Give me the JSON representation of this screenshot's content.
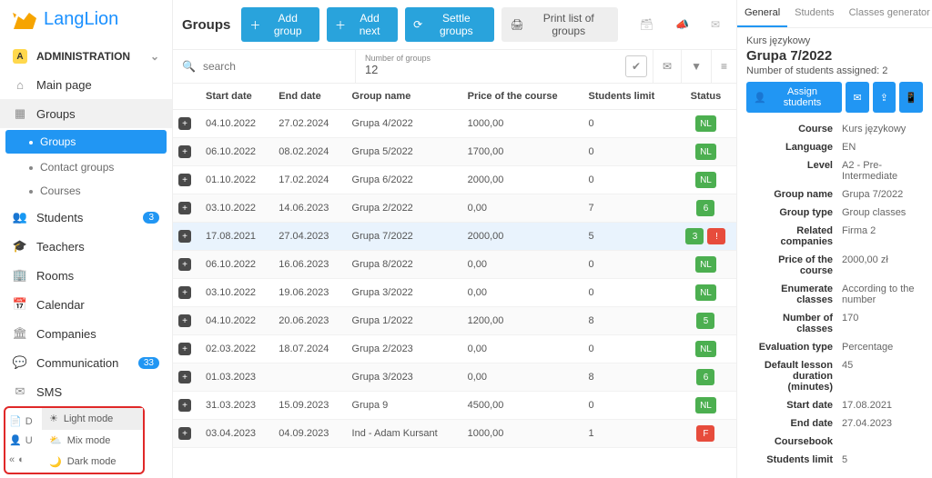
{
  "brand": "LangLion",
  "sidebar": {
    "adminBadge": "A",
    "adminLabel": "ADMINISTRATION",
    "items": [
      {
        "label": "Main page"
      },
      {
        "label": "Groups"
      },
      {
        "label": "Students",
        "badge": "3"
      },
      {
        "label": "Teachers"
      },
      {
        "label": "Rooms"
      },
      {
        "label": "Calendar"
      },
      {
        "label": "Companies"
      },
      {
        "label": "Communication",
        "badge": "33"
      },
      {
        "label": "SMS"
      },
      {
        "label": "D"
      },
      {
        "label": "U"
      }
    ],
    "subgroups": [
      {
        "label": "Groups",
        "active": true
      },
      {
        "label": "Contact groups"
      },
      {
        "label": "Courses"
      }
    ]
  },
  "modes": {
    "light": "Light mode",
    "mix": "Mix mode",
    "dark": "Dark mode"
  },
  "header": {
    "title": "Groups",
    "addGroup": "Add group",
    "addNext": "Add next",
    "settle": "Settle groups",
    "print": "Print list of groups"
  },
  "filter": {
    "search_ph": "search",
    "ngroups_label": "Number of groups",
    "ngroups_value": "12"
  },
  "columns": {
    "start": "Start date",
    "end": "End date",
    "group": "Group name",
    "price": "Price of the course",
    "limit": "Students limit",
    "status": "Status"
  },
  "rows": [
    {
      "start": "04.10.2022",
      "end": "27.02.2024",
      "group": "Grupa 4/2022",
      "price": "1000,00",
      "limit": "0",
      "status": [
        "NL"
      ]
    },
    {
      "start": "06.10.2022",
      "end": "08.02.2024",
      "group": "Grupa 5/2022",
      "price": "1700,00",
      "limit": "0",
      "status": [
        "NL"
      ]
    },
    {
      "start": "01.10.2022",
      "end": "17.02.2024",
      "group": "Grupa 6/2022",
      "price": "2000,00",
      "limit": "0",
      "status": [
        "NL"
      ]
    },
    {
      "start": "03.10.2022",
      "end": "14.06.2023",
      "group": "Grupa 2/2022",
      "price": "0,00",
      "limit": "7",
      "status": [
        "6"
      ]
    },
    {
      "start": "17.08.2021",
      "end": "27.04.2023",
      "group": "Grupa 7/2022",
      "price": "2000,00",
      "limit": "5",
      "status": [
        "3",
        "!"
      ],
      "selected": true
    },
    {
      "start": "06.10.2022",
      "end": "16.06.2023",
      "group": "Grupa 8/2022",
      "price": "0,00",
      "limit": "0",
      "status": [
        "NL"
      ]
    },
    {
      "start": "03.10.2022",
      "end": "19.06.2023",
      "group": "Grupa 3/2022",
      "price": "0,00",
      "limit": "0",
      "status": [
        "NL"
      ]
    },
    {
      "start": "04.10.2022",
      "end": "20.06.2023",
      "group": "Grupa 1/2022",
      "price": "1200,00",
      "limit": "8",
      "status": [
        "5"
      ]
    },
    {
      "start": "02.03.2022",
      "end": "18.07.2024",
      "group": "Grupa 2/2023",
      "price": "0,00",
      "limit": "0",
      "status": [
        "NL"
      ]
    },
    {
      "start": "01.03.2023",
      "end": "",
      "group": "Grupa 3/2023",
      "price": "0,00",
      "limit": "8",
      "status": [
        "6"
      ]
    },
    {
      "start": "31.03.2023",
      "end": "15.09.2023",
      "group": "Grupa 9",
      "price": "4500,00",
      "limit": "0",
      "status": [
        "NL"
      ]
    },
    {
      "start": "03.04.2023",
      "end": "04.09.2023",
      "group": "Ind - Adam Kursant",
      "price": "1000,00",
      "limit": "1",
      "status": [
        "F"
      ]
    }
  ],
  "right": {
    "tabs": {
      "general": "General",
      "students": "Students",
      "classes": "Classes generator"
    },
    "sup": "Kurs językowy",
    "title": "Grupa 7/2022",
    "assigned_lbl": "Number of students assigned: ",
    "assigned_val": "2",
    "assignBtn": "Assign students",
    "props": [
      {
        "k": "Course",
        "v": "Kurs językowy"
      },
      {
        "k": "Language",
        "v": "EN"
      },
      {
        "k": "Level",
        "v": "A2 - Pre-Intermediate"
      },
      {
        "k": "Group name",
        "v": "Grupa 7/2022"
      },
      {
        "k": "Group type",
        "v": "Group classes"
      },
      {
        "k": "Related companies",
        "v": "Firma 2"
      },
      {
        "k": "Price of the course",
        "v": "2000,00 zł"
      },
      {
        "k": "Enumerate classes",
        "v": "According to the number"
      },
      {
        "k": "Number of classes",
        "v": "170"
      },
      {
        "k": "Evaluation type",
        "v": "Percentage"
      },
      {
        "k": "Default lesson duration (minutes)",
        "v": "45"
      },
      {
        "k": "Start date",
        "v": "17.08.2021"
      },
      {
        "k": "End date",
        "v": "27.04.2023"
      },
      {
        "k": "Coursebook",
        "v": ""
      },
      {
        "k": "Students limit",
        "v": "5"
      }
    ]
  }
}
